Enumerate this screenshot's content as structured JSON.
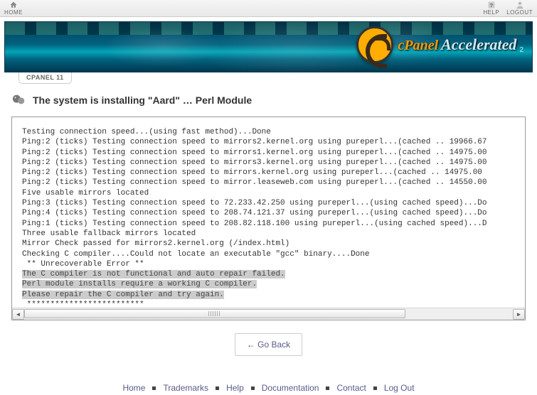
{
  "topbar": {
    "home": "HOME",
    "help": "HELP",
    "logout": "LOGOUT"
  },
  "brand": {
    "cpanel": "cPanel",
    "accelerated": "Accelerated",
    "sub": "2"
  },
  "tab": {
    "label": "CPANEL 11"
  },
  "page": {
    "title": "The system is installing \"Aard\" … Perl Module"
  },
  "console": {
    "lines_pre": "Testing connection speed...(using fast method)...Done\nPing:2 (ticks) Testing connection speed to mirrors2.kernel.org using pureperl...(cached .. 19966.67\nPing:2 (ticks) Testing connection speed to mirrors1.kernel.org using pureperl...(cached .. 14975.00\nPing:2 (ticks) Testing connection speed to mirrors3.kernel.org using pureperl...(cached .. 14975.00\nPing:2 (ticks) Testing connection speed to mirrors.kernel.org using pureperl...(cached .. 14975.00\nPing:2 (ticks) Testing connection speed to mirror.leaseweb.com using pureperl...(cached .. 14550.00\nFive usable mirrors located\nPing:3 (ticks) Testing connection speed to 72.233.42.250 using pureperl...(using cached speed)...Do\nPing:4 (ticks) Testing connection speed to 208.74.121.37 using pureperl...(using cached speed)...Do\nPing:1 (ticks) Testing connection speed to 208.82.118.100 using pureperl...(using cached speed)...D\nThree usable fallback mirrors located\nMirror Check passed for mirrors2.kernel.org (/index.html)\nChecking C compiler....Could not locate an executable \"gcc\" binary....Done\n ** Unrecoverable Error **",
    "hl1": "The C compiler is not functional and auto repair failed.",
    "hl2": "Perl module installs require a working C compiler.",
    "hl3": "Please repair the C compiler and try again.",
    "lines_post": " *************************"
  },
  "buttons": {
    "go_back": "← Go Back"
  },
  "footer": {
    "links": [
      "Home",
      "Trademarks",
      "Help",
      "Documentation",
      "Contact",
      "Log Out"
    ]
  }
}
